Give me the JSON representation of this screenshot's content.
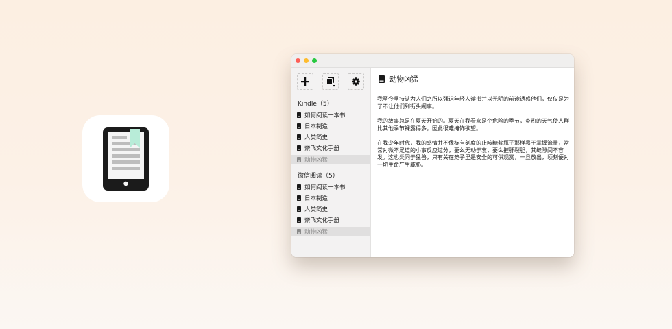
{
  "app_icon": {
    "name": "ebook-reader-icon",
    "accent": "#b8ecd8"
  },
  "window": {
    "toolbar": {
      "add_icon": "plus-icon",
      "library_icon": "stacked-books-icon",
      "settings_icon": "gear-icon"
    },
    "sections": [
      {
        "title": "Kindle（5）",
        "items": [
          {
            "label": "如何阅读一本书"
          },
          {
            "label": "日本制造"
          },
          {
            "label": "人类简史"
          },
          {
            "label": "奈飞文化手册"
          },
          {
            "label": "动物凶猛",
            "selected": true
          }
        ]
      },
      {
        "title": "微信阅读（5）",
        "items": [
          {
            "label": "如何阅读一本书"
          },
          {
            "label": "日本制造"
          },
          {
            "label": "人类简史"
          },
          {
            "label": "奈飞文化手册"
          },
          {
            "label": "动物凶猛",
            "selected": true
          }
        ]
      }
    ],
    "main": {
      "title": "动物凶猛",
      "paragraphs": [
        "我至今坚持认为人们之所以强迫年轻人读书并以光明的前途诱惑他们，仅仅是为了不让他们到街头闹事。",
        "我的故事总是在夏天开始的。夏天在我看来是个危险的季节，炎热的天气使人群比其他季节裸露得多，因此很难掩饰欲望。",
        "在我少年时代，我的感情并不像标有刻度的止咳糖浆瓶子那样易于掌握流量，常常对微不足道的小事反应过分，要么无动于衷，要么摧肝裂胆，其缝隙间不容发。这也类同于猛兽，只有关在笼子里是安全的可供观赏，一旦放出，顷刻便对一切生命产生威胁。"
      ]
    }
  }
}
